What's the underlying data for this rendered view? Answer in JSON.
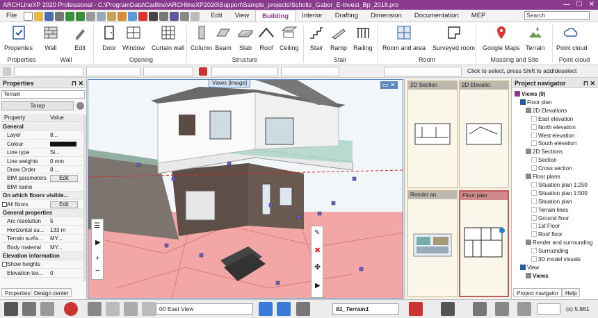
{
  "window": {
    "title": "ARCHLineXP 2020  Professional - C:\\ProgramData\\Cadline\\ARCHlineXP2020\\Support\\Sample_projects\\Scholtz_Gabor_E-Invest_Bp_2018.pro",
    "min": "—",
    "max": "☐",
    "close": "✕"
  },
  "tabs": [
    "File",
    "Edit",
    "View",
    "Building",
    "Interior",
    "Drafting",
    "Dimension",
    "Documentation",
    "MEP"
  ],
  "active_tab": "Building",
  "search": {
    "placeholder": "Search"
  },
  "ribbon": {
    "buttons": [
      {
        "label": "Properties",
        "icon": "properties-icon"
      },
      {
        "label": "Wall",
        "icon": "wall-icon"
      },
      {
        "label": "Edit",
        "icon": "edit-icon"
      },
      {
        "label": "Door",
        "icon": "door-icon"
      },
      {
        "label": "Window",
        "icon": "window-icon"
      },
      {
        "label": "Curtain wall",
        "icon": "curtain-wall-icon"
      },
      {
        "label": "Column",
        "icon": "column-icon"
      },
      {
        "label": "Beam",
        "icon": "beam-icon"
      },
      {
        "label": "Slab",
        "icon": "slab-icon"
      },
      {
        "label": "Roof",
        "icon": "roof-icon"
      },
      {
        "label": "Ceiling",
        "icon": "ceiling-icon"
      },
      {
        "label": "Stair",
        "icon": "stair-icon"
      },
      {
        "label": "Ramp",
        "icon": "ramp-icon"
      },
      {
        "label": "Railing",
        "icon": "railing-icon"
      },
      {
        "label": "Room and area",
        "icon": "room-icon"
      },
      {
        "label": "Surveyed room",
        "icon": "surveyed-room-icon"
      },
      {
        "label": "Google Maps",
        "icon": "google-maps-icon"
      },
      {
        "label": "Terrain",
        "icon": "terrain-icon"
      },
      {
        "label": "Point cloud",
        "icon": "point-cloud-icon"
      }
    ],
    "groups": [
      "Properties",
      "Wall",
      "Opening",
      "Structure",
      "Stair",
      "Room",
      "Massing and Site",
      "Point cloud"
    ]
  },
  "toolbar2": {
    "hint": "Click to select, press Shift to add/deselect"
  },
  "properties": {
    "title": "Properties",
    "type_value": "Terrain",
    "object_button": "Terep",
    "col_property": "Property",
    "col_value": "Value",
    "rows": [
      {
        "k": "General",
        "v": "",
        "sec": true
      },
      {
        "k": "Layer",
        "v": "8..."
      },
      {
        "k": "Colour",
        "v": ""
      },
      {
        "k": "Line type",
        "v": "Si..."
      },
      {
        "k": "Line weights",
        "v": "0 mm"
      },
      {
        "k": "Draw Order",
        "v": "8 ..."
      },
      {
        "k": "BIM parameters",
        "v": "Edit"
      },
      {
        "k": "BIM name",
        "v": ""
      },
      {
        "k": "On which floors visible...",
        "v": "",
        "sec": true
      },
      {
        "k": "All floors",
        "v": "Edit"
      },
      {
        "k": "General properties",
        "v": "",
        "sec": true
      },
      {
        "k": "Arc resolution",
        "v": "5"
      },
      {
        "k": "Horizontal su...",
        "v": "133 m"
      },
      {
        "k": "Terrain surfa...",
        "v": "MY..."
      },
      {
        "k": "Body material",
        "v": "MY..."
      },
      {
        "k": "Elevation information",
        "v": "",
        "sec": true
      },
      {
        "k": "Show heights",
        "v": ""
      },
      {
        "k": "Elevation tex...",
        "v": "0"
      }
    ],
    "tab_properties": "Properties",
    "tab_design": "Design center"
  },
  "viewport": {
    "tab": "Views [Image]"
  },
  "thumbnails": [
    {
      "label": "2D Section"
    },
    {
      "label": "2D Elevatio"
    },
    {
      "label": "Render an"
    },
    {
      "label": "Floor plan"
    }
  ],
  "navigator": {
    "title": "Project navigator",
    "items": [
      {
        "t": "Views (9)",
        "l": 0,
        "b": true
      },
      {
        "t": "Floor plan",
        "l": 1
      },
      {
        "t": "2D Elevations",
        "l": 2
      },
      {
        "t": "East elevation",
        "l": 3
      },
      {
        "t": "North elevation",
        "l": 3
      },
      {
        "t": "West elevation",
        "l": 3
      },
      {
        "t": "South elevation",
        "l": 3
      },
      {
        "t": "2D Sections",
        "l": 2
      },
      {
        "t": "Section",
        "l": 3
      },
      {
        "t": "Cross section",
        "l": 3
      },
      {
        "t": "Floor plans",
        "l": 2
      },
      {
        "t": "Situation plan 1:250",
        "l": 3
      },
      {
        "t": "Situation plan 1:500",
        "l": 3
      },
      {
        "t": "Situation plan",
        "l": 3
      },
      {
        "t": "Terrain lines",
        "l": 3
      },
      {
        "t": "Ground floor",
        "l": 3
      },
      {
        "t": "1st Floor",
        "l": 3
      },
      {
        "t": "Roof floor",
        "l": 3
      },
      {
        "t": "Render and surrounding",
        "l": 2
      },
      {
        "t": "Surrounding",
        "l": 3
      },
      {
        "t": "3D model visuals",
        "l": 3
      },
      {
        "t": "View",
        "l": 1
      },
      {
        "t": "Views",
        "l": 2,
        "b": true
      }
    ],
    "tab_nav": "Project navigator",
    "tab_help": "Help"
  },
  "bottom": {
    "view_select": "00 East View",
    "layer": "81_Terrain1",
    "coord": "(x) 5.861"
  }
}
